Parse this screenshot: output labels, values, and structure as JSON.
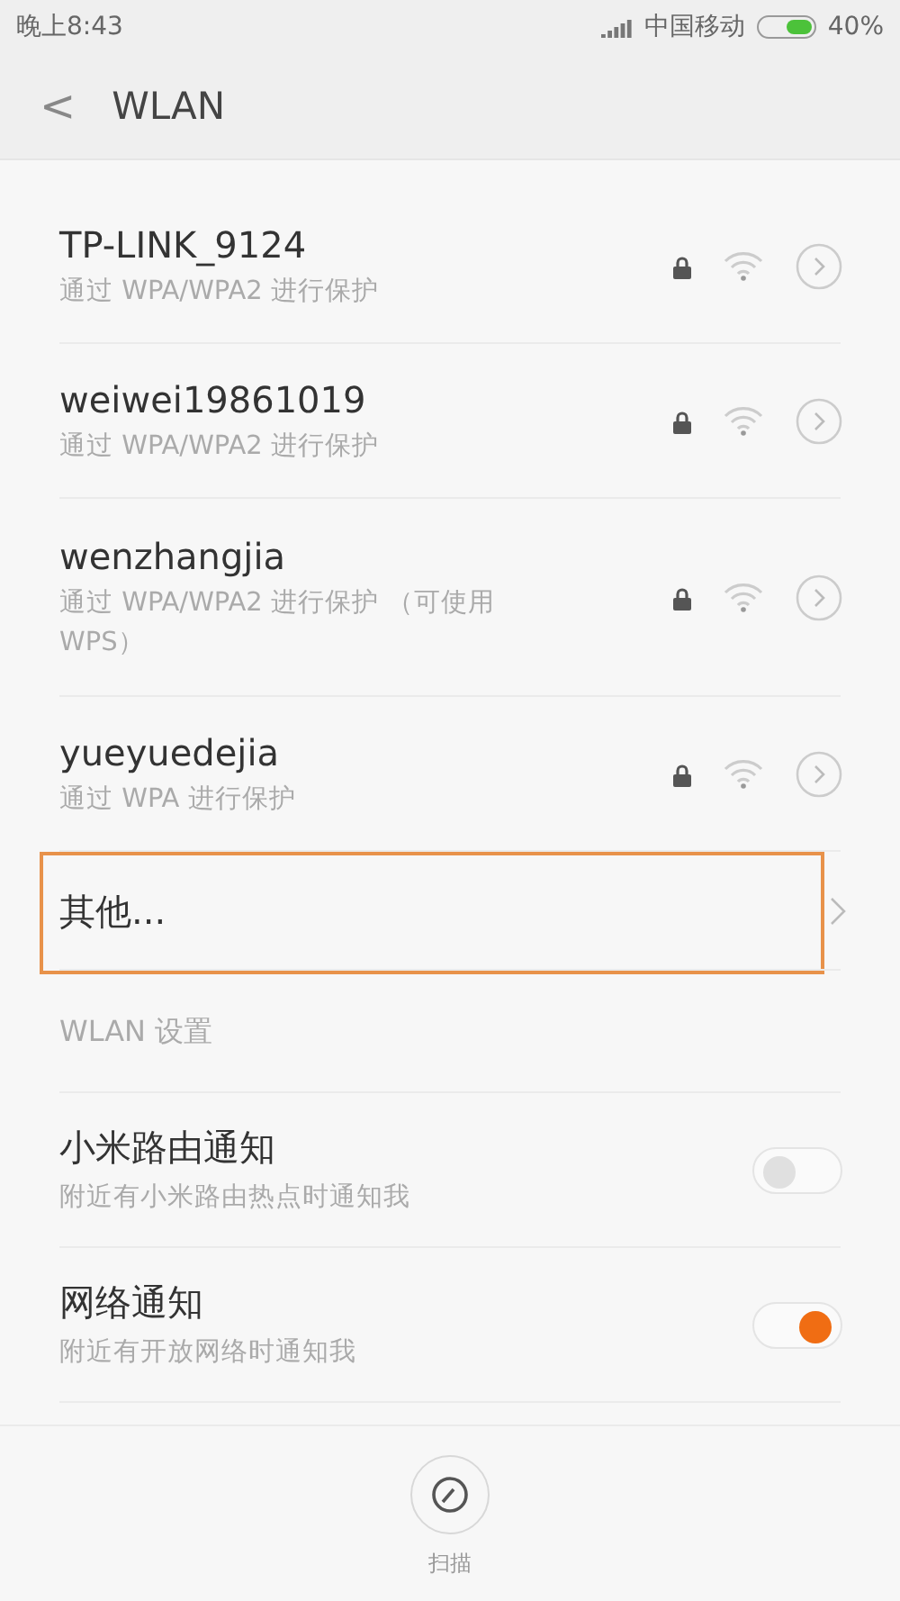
{
  "status_bar": {
    "time": "晚上8:43",
    "carrier": "中国移动",
    "battery": "40%"
  },
  "header": {
    "back": "<",
    "title": "WLAN"
  },
  "networks": [
    {
      "name": "TP-LINK_9124",
      "security": "通过 WPA/WPA2 进行保护",
      "locked": true
    },
    {
      "name": "weiwei19861019",
      "security": "通过 WPA/WPA2 进行保护",
      "locked": true
    },
    {
      "name": "wenzhangjia",
      "security": "通过 WPA/WPA2 进行保护 （可使用 WPS）",
      "locked": true
    },
    {
      "name": "yueyuedejia",
      "security": "通过 WPA 进行保护",
      "locked": true
    }
  ],
  "other": {
    "label": "其他...",
    "highlighted": true
  },
  "settings": {
    "header": "WLAN 设置",
    "items": [
      {
        "title": "小米路由通知",
        "subtitle": "附近有小米路由热点时通知我",
        "on": false
      },
      {
        "title": "网络通知",
        "subtitle": "附近有开放网络时通知我",
        "on": true
      }
    ]
  },
  "bottom_bar": {
    "buttons": [
      {
        "label": "扫描"
      }
    ]
  }
}
